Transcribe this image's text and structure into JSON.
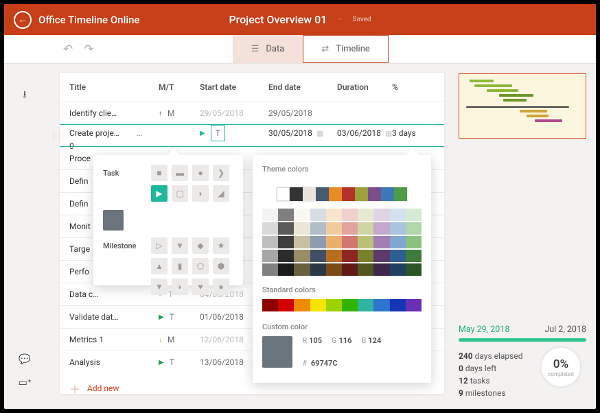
{
  "header": {
    "app_name": "Office Timeline Online",
    "doc_title": "Project Overview 01",
    "saved_label": "Saved"
  },
  "tabs": {
    "data": "Data",
    "timeline": "Timeline"
  },
  "columns": {
    "title": "Title",
    "mt": "M/T",
    "start": "Start date",
    "end": "End date",
    "duration": "Duration",
    "pct": "%"
  },
  "rows": [
    {
      "title": "Identify clie…",
      "icon": "arrow-up",
      "iconcolor": "#333",
      "mt": "M",
      "start": "29/05/2018",
      "end": "29/05/2018",
      "dur": "",
      "pct": "",
      "startDim": true
    },
    {
      "title": "Create proje…",
      "icon": "play",
      "iconcolor": "#1db89c",
      "mt": "T",
      "start": "30/05/2018",
      "end": "03/06/2018",
      "dur": "3 days",
      "pct": "0",
      "selected": true,
      "drag": true,
      "dots": true,
      "cal": true
    },
    {
      "title": "Proce",
      "faded": true
    },
    {
      "title": "Defin",
      "faded": true
    },
    {
      "title": "Defin",
      "faded": true
    },
    {
      "title": "Monit",
      "faded": true
    },
    {
      "title": "Targe",
      "faded": true
    },
    {
      "title": "Perfo",
      "faded": true
    },
    {
      "title": "Data c…",
      "icon": "eye-off",
      "iconcolor": "#bbb",
      "mt": "T",
      "start": "04/06/2018",
      "allDim": true
    },
    {
      "title": "Validate dat…",
      "icon": "play",
      "iconcolor": "#1ea554",
      "mt": "T",
      "start": "01/06/2018"
    },
    {
      "title": "Metrics 1",
      "icon": "arrow-down",
      "iconcolor": "#6fbf2f",
      "mt": "M",
      "start": "12/06/2018",
      "startDim": true
    },
    {
      "title": "Analysis",
      "icon": "play",
      "iconcolor": "#1ea554",
      "mt": "T",
      "start": "13/06/2018"
    }
  ],
  "add_new": "Add new",
  "shape_popup": {
    "task_label": "Task",
    "milestone_label": "Milestone"
  },
  "color_popup": {
    "theme_label": "Theme colors",
    "standard_label": "Standard colors",
    "custom_label": "Custom color",
    "r": "105",
    "g": "116",
    "b": "124",
    "hex": "69747C",
    "theme_main": [
      "#ffffff",
      "#333333",
      "#e9e5dd",
      "#475b71",
      "#e98b24",
      "#b5312b",
      "#9aa238",
      "#7a4d8d",
      "#3b78b6",
      "#4e9b47"
    ],
    "theme_shades": [
      [
        "#f3f3f3",
        "#808080",
        "#faf8f2",
        "#d7dde4",
        "#f9e5cd",
        "#f0d0cd",
        "#e7ead0",
        "#e0d3e6",
        "#d3e1f0",
        "#d7ead3"
      ],
      [
        "#d9d9d9",
        "#5a5a5a",
        "#ece6d6",
        "#b2bdca",
        "#f2cb9c",
        "#e1a39d",
        "#d0d6a3",
        "#c2a8cd",
        "#a9c4e1",
        "#b1d6a9"
      ],
      [
        "#bfbfbf",
        "#3e3e3e",
        "#c9bfa3",
        "#8d9cb0",
        "#ebb16b",
        "#d27670",
        "#b9c276",
        "#a47db4",
        "#7fa7d2",
        "#8bc17f"
      ],
      [
        "#a6a6a6",
        "#2b2b2b",
        "#9a8e69",
        "#3f5064",
        "#b96e1d",
        "#8e2722",
        "#7a812d",
        "#5d3a6b",
        "#2e5f91",
        "#3e7c39"
      ],
      [
        "#808080",
        "#1b1b1b",
        "#6a5f3e",
        "#2a3846",
        "#7c4a14",
        "#5f1a16",
        "#52571e",
        "#3e2748",
        "#1f4061",
        "#2a5326"
      ]
    ],
    "standard": [
      "#8e0000",
      "#d30000",
      "#ef8b00",
      "#f7e400",
      "#9ed100",
      "#2fb400",
      "#2fb4a0",
      "#2f74d1",
      "#1436b4",
      "#6a2fb4"
    ]
  },
  "thumb_bars": [
    {
      "l": 5,
      "w": 35,
      "c": "#8fb83a"
    },
    {
      "l": 12,
      "w": 55,
      "c": "#8fb83a"
    },
    {
      "l": 30,
      "w": 46,
      "c": "#8fb83a"
    },
    {
      "l": 48,
      "w": 50,
      "c": "#6e9729"
    },
    {
      "l": 54,
      "w": 34,
      "c": "#6e9729"
    },
    {
      "l": 0,
      "w": 150,
      "c": "#3d3d3d",
      "h": 2,
      "mt": 4
    },
    {
      "l": 78,
      "w": 40,
      "c": "#cda53b"
    },
    {
      "l": 88,
      "w": 32,
      "c": "#cda53b"
    },
    {
      "l": 100,
      "w": 40,
      "c": "#b14a8b"
    }
  ],
  "stats": {
    "from": "May 29, 2018",
    "to": "Jul 2, 2018",
    "elapsed_n": "240",
    "elapsed_l": "days elapsed",
    "left_n": "0",
    "left_l": "days left",
    "tasks_n": "12",
    "tasks_l": "tasks",
    "ms_n": "9",
    "ms_l": "milestones",
    "pct": "0%",
    "pct_l": "completed"
  }
}
